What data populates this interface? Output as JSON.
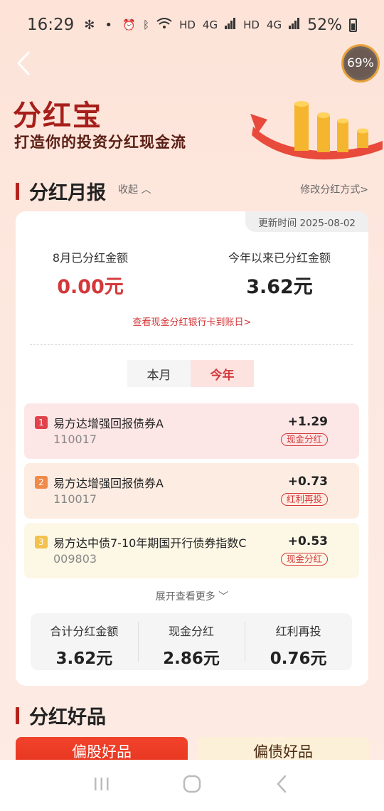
{
  "status": {
    "time": "16:29",
    "battery": "52%",
    "net1": "HD",
    "net2": "4G",
    "net3": "HD",
    "net4": "4G"
  },
  "progress_badge": "69%",
  "brand": {
    "title": "分红宝",
    "subtitle": "打造你的投资分红现金流"
  },
  "monthly_report": {
    "title": "分红月报",
    "collapse_label": "收起",
    "modify_label": "修改分红方式>",
    "updated": "更新时间 2025-08-02",
    "month_label": "8月已分红金额",
    "month_value": "0.00元",
    "year_label": "今年以来已分红金额",
    "year_value": "3.62元",
    "bank_link": "查看现金分红银行卡到账日>",
    "tabs": [
      "本月",
      "今年"
    ],
    "active_tab": "今年",
    "funds": [
      {
        "rank": "1",
        "name": "易方达增强回报债券A",
        "code": "110017",
        "amount": "+1.29",
        "tag": "现金分红"
      },
      {
        "rank": "2",
        "name": "易方达增强回报债券A",
        "code": "110017",
        "amount": "+0.73",
        "tag": "红利再投"
      },
      {
        "rank": "3",
        "name": "易方达中债7-10年期国开行债券指数C",
        "code": "009803",
        "amount": "+0.53",
        "tag": "现金分红"
      }
    ],
    "expand_label": "展开查看更多",
    "summary": [
      {
        "label": "合计分红金额",
        "value": "3.62元"
      },
      {
        "label": "现金分红",
        "value": "2.86元"
      },
      {
        "label": "红利再投",
        "value": "0.76元"
      }
    ]
  },
  "good_products": {
    "title": "分红好品",
    "tabs": [
      "偏股好品",
      "偏债好品"
    ]
  },
  "colors": {
    "accent_red": "#d4383a",
    "brand_red": "#a61f1a",
    "rank1": "#e0434a",
    "rank2": "#f08a4b",
    "rank3": "#f2c14e"
  }
}
